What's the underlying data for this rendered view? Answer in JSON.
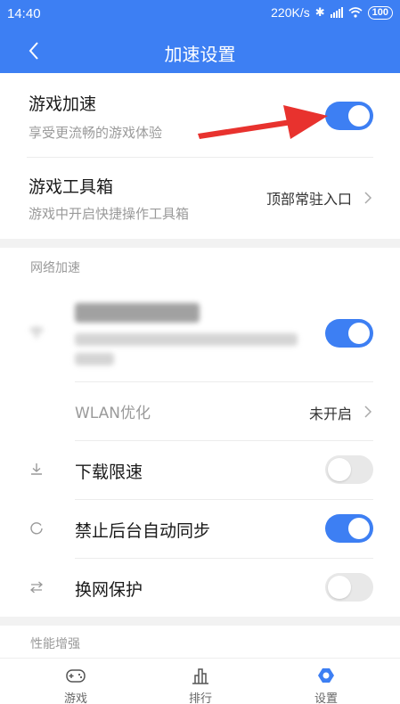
{
  "status": {
    "time": "14:40",
    "net_speed": "220K/s",
    "battery": "100"
  },
  "header": {
    "title": "加速设置"
  },
  "rows": {
    "game_boost": {
      "title": "游戏加速",
      "subtitle": "享受更流畅的游戏体验",
      "enabled": true
    },
    "toolbox": {
      "title": "游戏工具箱",
      "subtitle": "游戏中开启快捷操作工具箱",
      "value": "顶部常驻入口"
    },
    "wlan_opt": {
      "label": "WLAN优化",
      "value": "未开启"
    },
    "download_limit": {
      "label": "下载限速",
      "enabled": false
    },
    "bg_sync": {
      "label": "禁止后台自动同步",
      "enabled": true
    },
    "net_switch": {
      "label": "换网保护",
      "enabled": false
    }
  },
  "sections": {
    "network": "网络加速",
    "performance": "性能增强"
  },
  "nav": [
    {
      "label": "游戏",
      "icon": "gamepad-icon"
    },
    {
      "label": "排行",
      "icon": "chart-icon"
    },
    {
      "label": "设置",
      "icon": "settings-icon"
    }
  ],
  "colors": {
    "accent": "#3d7ff3",
    "arrow": "#e8322e",
    "toggle_off": "#e8e8e8"
  }
}
